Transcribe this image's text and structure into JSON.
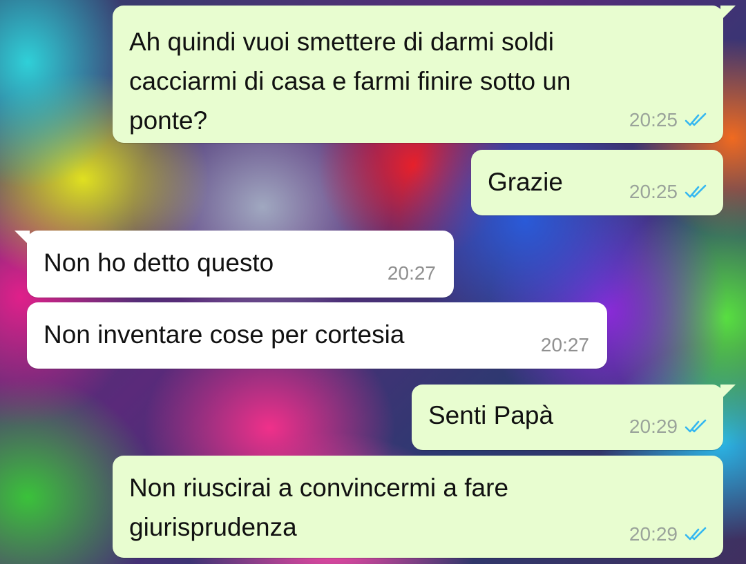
{
  "conversation": {
    "messages": [
      {
        "direction": "outgoing",
        "text": "Ah quindi vuoi smettere di darmi soldi\ncacciarmi di casa e farmi finire sotto un\nponte?",
        "time": "20:25",
        "status": "read"
      },
      {
        "direction": "outgoing",
        "text": "Grazie",
        "time": "20:25",
        "status": "read"
      },
      {
        "direction": "incoming",
        "text": "Non ho detto questo",
        "time": "20:27"
      },
      {
        "direction": "incoming",
        "text": "Non inventare cose per cortesia",
        "time": "20:27"
      },
      {
        "direction": "outgoing",
        "text": "Senti Papà",
        "time": "20:29",
        "status": "read"
      },
      {
        "direction": "outgoing",
        "text": "Non riuscirai a convincermi a fare\ngiurisprudenza",
        "time": "20:29",
        "status": "read"
      }
    ]
  },
  "colors": {
    "outgoing_bubble": "#e8fdd0",
    "incoming_bubble": "#ffffff",
    "read_ticks": "#34b7f1"
  },
  "icons": {
    "read_receipt": "double-check-icon"
  }
}
